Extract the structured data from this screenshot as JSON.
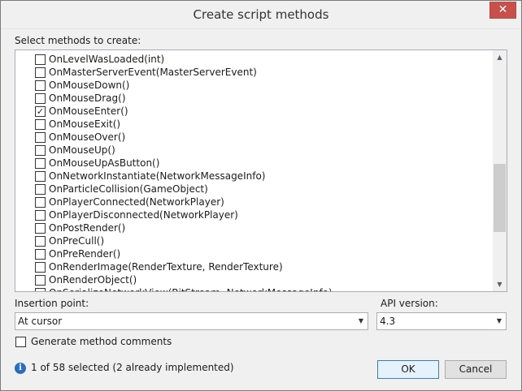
{
  "window": {
    "title": "Create script methods",
    "close_glyph": "✕"
  },
  "methods_label": "Select methods to create:",
  "methods": [
    {
      "label": "OnLevelWasLoaded(int)",
      "checked": false
    },
    {
      "label": "OnMasterServerEvent(MasterServerEvent)",
      "checked": false
    },
    {
      "label": "OnMouseDown()",
      "checked": false
    },
    {
      "label": "OnMouseDrag()",
      "checked": false
    },
    {
      "label": "OnMouseEnter()",
      "checked": true
    },
    {
      "label": "OnMouseExit()",
      "checked": false
    },
    {
      "label": "OnMouseOver()",
      "checked": false
    },
    {
      "label": "OnMouseUp()",
      "checked": false
    },
    {
      "label": "OnMouseUpAsButton()",
      "checked": false
    },
    {
      "label": "OnNetworkInstantiate(NetworkMessageInfo)",
      "checked": false
    },
    {
      "label": "OnParticleCollision(GameObject)",
      "checked": false
    },
    {
      "label": "OnPlayerConnected(NetworkPlayer)",
      "checked": false
    },
    {
      "label": "OnPlayerDisconnected(NetworkPlayer)",
      "checked": false
    },
    {
      "label": "OnPostRender()",
      "checked": false
    },
    {
      "label": "OnPreCull()",
      "checked": false
    },
    {
      "label": "OnPreRender()",
      "checked": false
    },
    {
      "label": "OnRenderImage(RenderTexture, RenderTexture)",
      "checked": false
    },
    {
      "label": "OnRenderObject()",
      "checked": false
    },
    {
      "label": "OnSerializeNetworkView(BitStream, NetworkMessageInfo)",
      "checked": false
    }
  ],
  "insertion": {
    "label": "Insertion point:",
    "value": "At cursor"
  },
  "api": {
    "label": "API version:",
    "value": "4.3"
  },
  "comments": {
    "label": "Generate method comments",
    "checked": false
  },
  "status": {
    "icon": "info-icon",
    "text": "1 of 58 selected (2 already implemented)"
  },
  "buttons": {
    "ok": "OK",
    "cancel": "Cancel"
  },
  "colors": {
    "accent": "#3c7fb1",
    "close": "#c7514a",
    "info": "#2a6ebd"
  }
}
